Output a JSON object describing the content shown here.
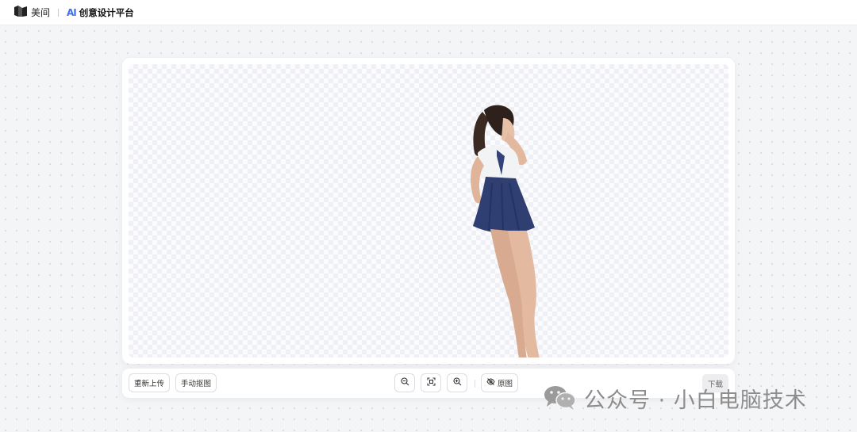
{
  "header": {
    "brand_name": "美间",
    "ai_label": "AI",
    "platform_name": "创意设计平台"
  },
  "toolbar": {
    "reupload_label": "重新上传",
    "manual_cutout_label": "手动抠图",
    "zoom_out_icon": "zoom-out-icon",
    "fit_icon": "fit-screen-icon",
    "zoom_in_icon": "zoom-in-icon",
    "original_label": "原图",
    "original_icon": "eye-off-icon",
    "download_label": "下载"
  },
  "watermark": {
    "text": "公众号 · 小白电脑技术",
    "icon": "wechat-icon"
  },
  "colors": {
    "accent": "#3f6df5",
    "background": "#f4f5f7"
  }
}
